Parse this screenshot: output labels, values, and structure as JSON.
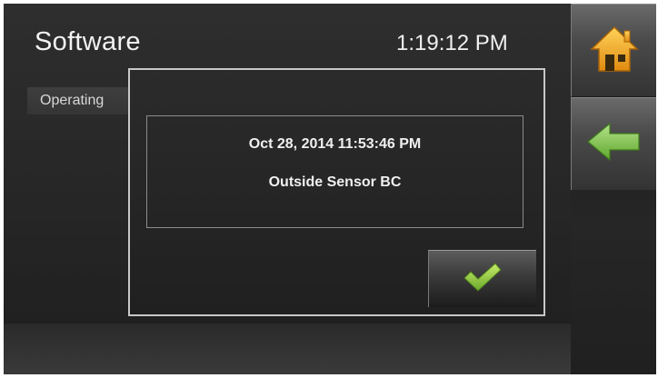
{
  "header": {
    "title": "Software",
    "clock": "1:19:12 PM"
  },
  "sidebar": {
    "home_icon": "home-icon",
    "back_icon": "back-arrow-icon"
  },
  "background_list": {
    "item_label": "Operating"
  },
  "dialog": {
    "timestamp": "Oct 28, 2014 11:53:46 PM",
    "message": "Outside Sensor BC",
    "confirm_icon": "checkmark-icon"
  },
  "colors": {
    "home_orange": "#f0a020",
    "back_green": "#7cc24a",
    "check_green": "#8ec43a"
  }
}
